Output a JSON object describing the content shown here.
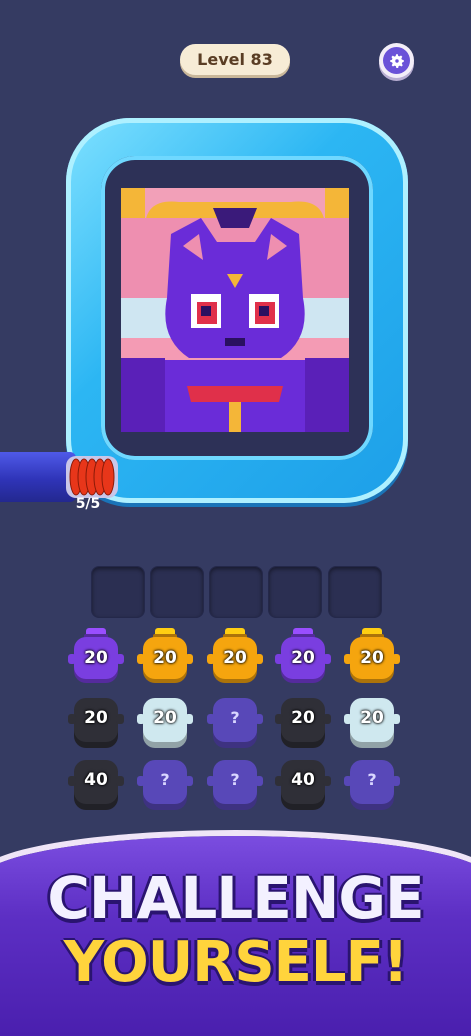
{
  "header": {
    "level_label": "Level 83",
    "settings_icon": "gear-icon"
  },
  "puzzle": {
    "image_subject": "purple cat pixel art",
    "counter_text": "5/5"
  },
  "slots": [
    {
      "state": "empty"
    },
    {
      "state": "empty"
    },
    {
      "state": "empty"
    },
    {
      "state": "empty"
    },
    {
      "state": "empty"
    }
  ],
  "jars": {
    "row1": [
      {
        "value": "20",
        "color": "#7a3ee0"
      },
      {
        "value": "20",
        "color": "#f5a50e"
      },
      {
        "value": "20",
        "color": "#f5a50e"
      },
      {
        "value": "20",
        "color": "#7a3ee0"
      },
      {
        "value": "20",
        "color": "#f5a50e"
      }
    ],
    "row2": [
      {
        "value": "20",
        "color": "#2f2f37"
      },
      {
        "value": "20",
        "color": "#cfe8ef"
      },
      {
        "value": "?",
        "color": "#5848b8"
      },
      {
        "value": "20",
        "color": "#2f2f37"
      },
      {
        "value": "20",
        "color": "#cfe8ef"
      }
    ],
    "row3": [
      {
        "value": "40",
        "color": "#2f2f37"
      },
      {
        "value": "?",
        "color": "#5848b8"
      },
      {
        "value": "?",
        "color": "#5848b8"
      },
      {
        "value": "40",
        "color": "#2f2f37"
      },
      {
        "value": "?",
        "color": "#5848b8"
      }
    ]
  },
  "banner": {
    "line1": "CHALLENGE",
    "line2": "YOURSELF!"
  }
}
